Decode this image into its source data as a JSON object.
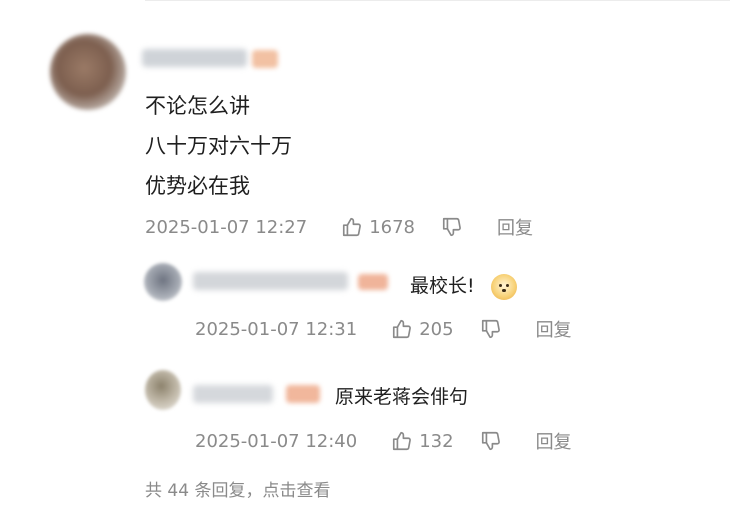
{
  "comment": {
    "lines": [
      "不论怎么讲",
      "八十万对六十万",
      "优势必在我"
    ],
    "timestamp": "2025-01-07 12:27",
    "likes": "1678",
    "reply_label": "回复"
  },
  "replies": [
    {
      "text": "最校长!",
      "emoji": "doge-icon",
      "timestamp": "2025-01-07 12:31",
      "likes": "205",
      "reply_label": "回复"
    },
    {
      "text": "原来老蒋会俳句",
      "timestamp": "2025-01-07 12:40",
      "likes": "132",
      "reply_label": "回复"
    }
  ],
  "more_replies": "共 44 条回复，点击查看",
  "colors": {
    "meta_text": "#8a8a8a",
    "body_text": "#1f1f1f",
    "badge": "#f2c1a3"
  }
}
